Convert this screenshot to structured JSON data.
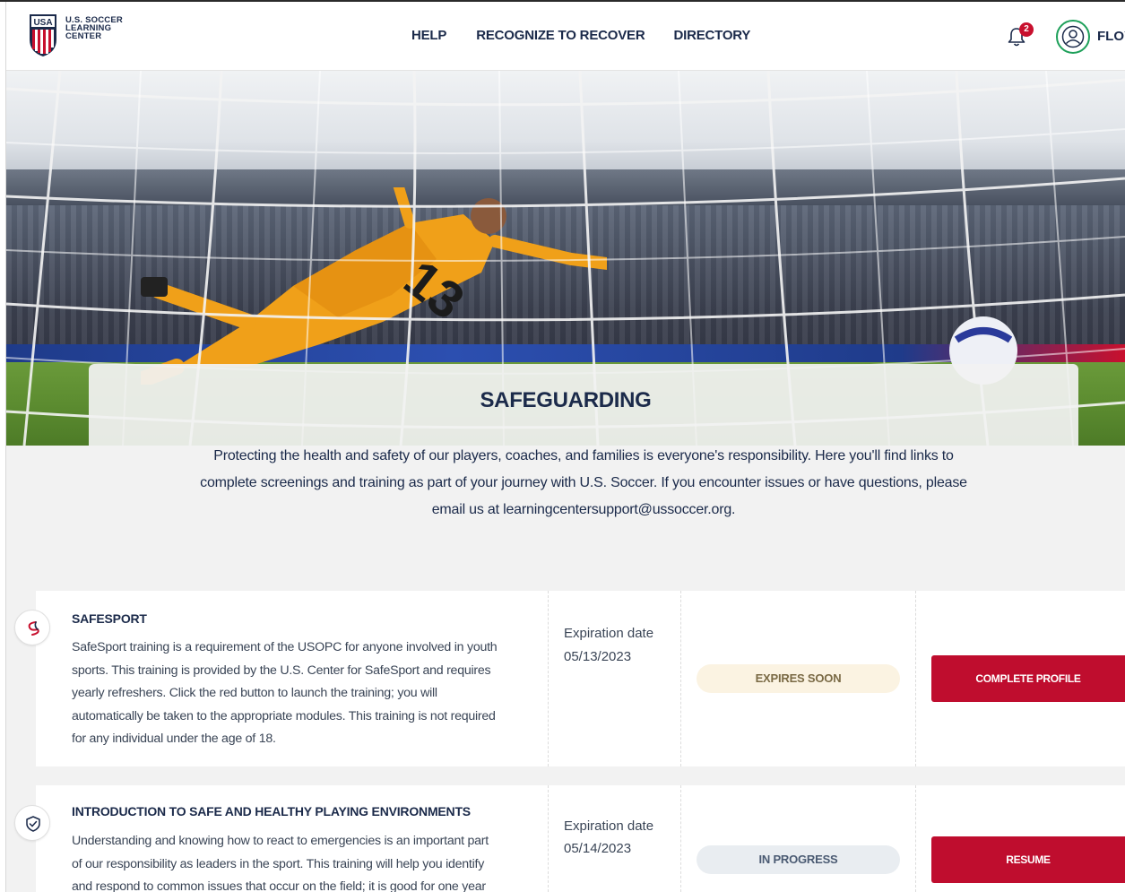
{
  "header": {
    "logo_lines": [
      "U.S. SOCCER",
      "LEARNING",
      "CENTER"
    ],
    "nav": [
      "HELP",
      "RECOGNIZE TO RECOVER",
      "DIRECTORY"
    ],
    "notification_count": "2",
    "user_name": "FLOY"
  },
  "hero": {
    "title": "SAFEGUARDING",
    "intro_lines": [
      "Protecting the health and safety of our players, coaches, and families is everyone's responsibility. Here you'll find links to",
      "complete screenings and training as part of your journey with U.S. Soccer. If you encounter issues or have questions, please",
      "email us at learningcentersupport@ussoccer.org."
    ]
  },
  "trainings": [
    {
      "title": "SAFESPORT",
      "description_lines": [
        "SafeSport training is a requirement of the USOPC for anyone involved in youth",
        "sports. This training is provided by the U.S. Center for SafeSport and requires",
        "yearly refreshers. Click the red button to launch the training; you will",
        "automatically be taken to the appropriate modules. This training is not required",
        "for any individual under the age of 18."
      ],
      "expiration_label": "Expiration date",
      "expiration_date": "05/13/2023",
      "status": "EXPIRES SOON",
      "action": "COMPLETE PROFILE",
      "icon": "safesport-icon"
    },
    {
      "title": "INTRODUCTION TO SAFE AND HEALTHY PLAYING ENVIRONMENTS",
      "description_lines": [
        "Understanding and knowing how to react to emergencies is an important part",
        "of our responsibility as leaders in the sport. This training will help you identify",
        "and respond to common issues that occur on the field; it is good for one year"
      ],
      "expiration_label": "Expiration date",
      "expiration_date": "05/14/2023",
      "status": "IN PROGRESS",
      "action": "RESUME",
      "icon": "shield-check-icon"
    }
  ],
  "colors": {
    "brand_red": "#bf0d2e",
    "navy": "#1b2a4a",
    "success_green": "#1ea05a"
  }
}
